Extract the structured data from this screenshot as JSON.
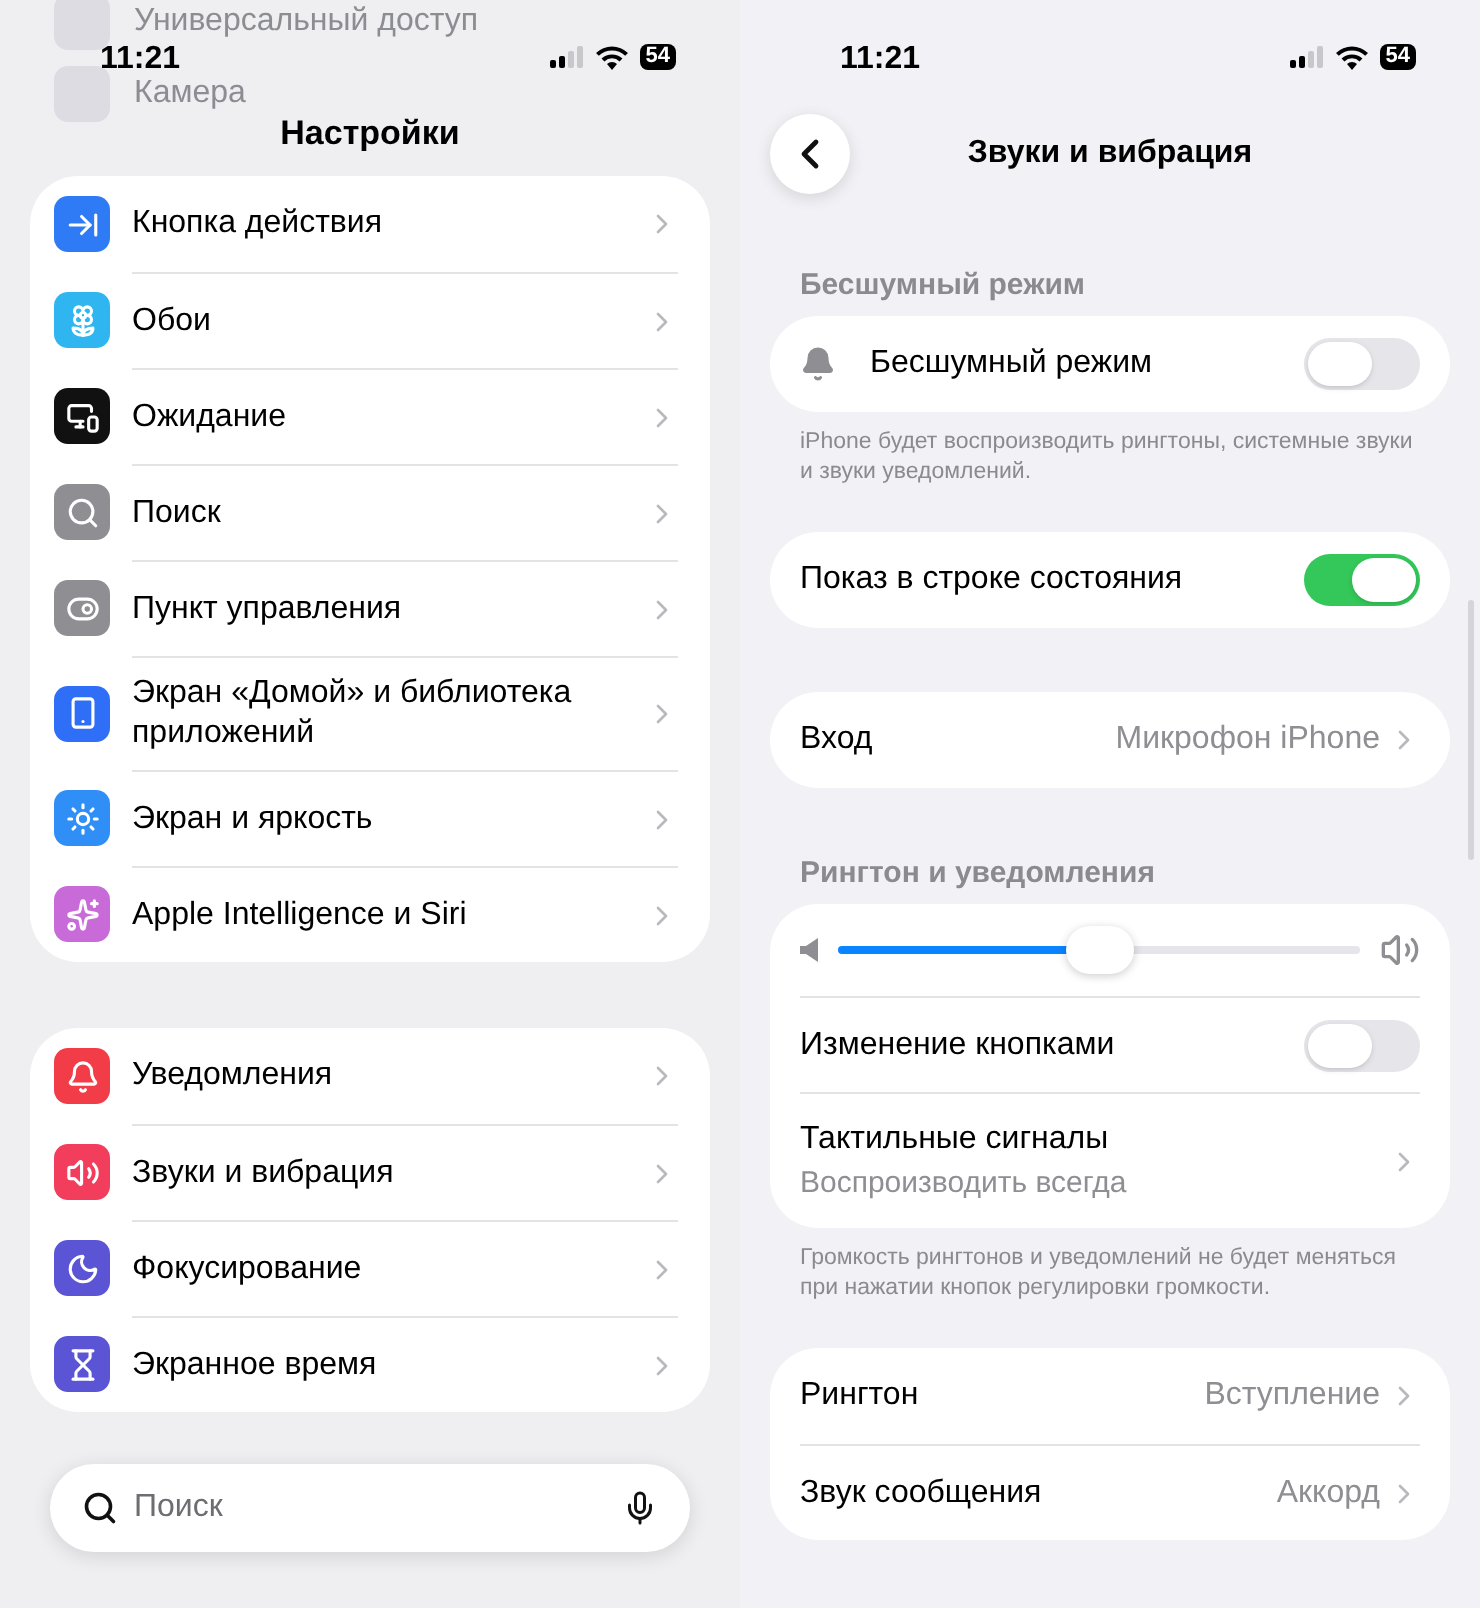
{
  "settings_screen": {
    "status_bar": {
      "time": "11:21",
      "battery": "54"
    },
    "background_items": [
      "Универсальный доступ",
      "Камера"
    ],
    "title": "Настройки",
    "groups": [
      [
        {
          "label": "Кнопка действия",
          "color": "#2f7bf6"
        },
        {
          "label": "Обои",
          "color": "#2fb6f0"
        },
        {
          "label": "Ожидание",
          "color": "#111111"
        },
        {
          "label": "Поиск",
          "color": "#8e8e93"
        },
        {
          "label": "Пункт управления",
          "color": "#8e8e93"
        },
        {
          "label": "Экран «Домой» и библиотека приложений",
          "color": "#2f6ef6"
        },
        {
          "label": "Экран и яркость",
          "color": "#2f8ff6"
        },
        {
          "label": "Apple Intelligence и Siri",
          "color": "#c86bd9"
        }
      ],
      [
        {
          "label": "Уведомления",
          "color": "#f23d48"
        },
        {
          "label": "Звуки и вибрация",
          "color": "#f23d5c"
        },
        {
          "label": "Фокусирование",
          "color": "#5b55d6"
        },
        {
          "label": "Экранное время",
          "color": "#5b55d6"
        }
      ]
    ],
    "search": {
      "placeholder": "Поиск"
    }
  },
  "sounds_screen": {
    "status_bar": {
      "time": "11:21",
      "battery": "54"
    },
    "title": "Звуки и вибрация",
    "sections": [
      {
        "header": "Бесшумный режим",
        "rows": [
          {
            "kind": "icon_toggle",
            "label": "Бесшумный режим",
            "on": false
          }
        ],
        "footer": "iPhone будет воспроизводить рингтоны, системные звуки и звуки уведомлений."
      },
      {
        "rows": [
          {
            "kind": "toggle",
            "label": "Показ в строке состояния",
            "on": true
          }
        ]
      },
      {
        "rows": [
          {
            "kind": "link",
            "label": "Вход",
            "value": "Микрофон iPhone"
          }
        ]
      },
      {
        "header": "Рингтон и уведомления",
        "rows": [
          {
            "kind": "slider",
            "level": 0.5
          },
          {
            "kind": "toggle",
            "label": "Изменение кнопками",
            "on": false
          },
          {
            "kind": "detail",
            "label": "Тактильные сигналы",
            "subtitle": "Воспроизводить всегда"
          }
        ],
        "footer": "Громкость рингтонов и уведомлений не будет меняться при нажатии кнопок регулировки громкости."
      },
      {
        "rows": [
          {
            "kind": "link",
            "label": "Рингтон",
            "value": "Вступление"
          },
          {
            "kind": "link",
            "label": "Звук сообщения",
            "value": "Аккорд"
          }
        ]
      }
    ]
  }
}
